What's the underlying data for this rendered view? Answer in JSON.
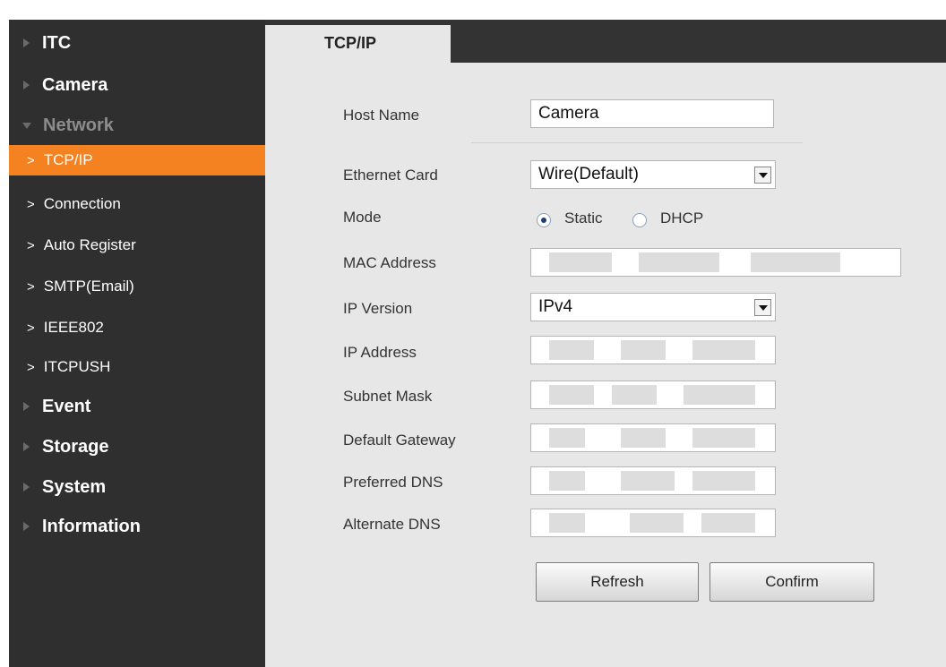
{
  "sidebar": {
    "top_items": [
      {
        "label": "ITC"
      },
      {
        "label": "Camera"
      },
      {
        "label": "Network"
      }
    ],
    "network_subitems": [
      {
        "label": "TCP/IP"
      },
      {
        "label": "Connection"
      },
      {
        "label": "Auto Register"
      },
      {
        "label": "SMTP(Email)"
      },
      {
        "label": "IEEE802"
      },
      {
        "label": "ITCPUSH"
      }
    ],
    "bottom_items": [
      {
        "label": "Event"
      },
      {
        "label": "Storage"
      },
      {
        "label": "System"
      },
      {
        "label": "Information"
      }
    ]
  },
  "tab": {
    "label": "TCP/IP"
  },
  "form": {
    "host_name": {
      "label": "Host Name",
      "value": "Camera"
    },
    "ethernet_card": {
      "label": "Ethernet Card",
      "value": "Wire(Default)"
    },
    "mode": {
      "label": "Mode",
      "options": [
        "Static",
        "DHCP"
      ],
      "selected": "Static"
    },
    "mac_address": {
      "label": "MAC Address"
    },
    "ip_version": {
      "label": "IP Version",
      "value": "IPv4"
    },
    "ip_address": {
      "label": "IP Address"
    },
    "subnet_mask": {
      "label": "Subnet Mask"
    },
    "default_gateway": {
      "label": "Default Gateway"
    },
    "preferred_dns": {
      "label": "Preferred DNS"
    },
    "alternate_dns": {
      "label": "Alternate DNS"
    }
  },
  "buttons": {
    "refresh": "Refresh",
    "confirm": "Confirm"
  },
  "colors": {
    "active_accent": "#f58220",
    "sidebar_bg": "#2f2f2f",
    "content_bg": "#e7e7e7"
  }
}
